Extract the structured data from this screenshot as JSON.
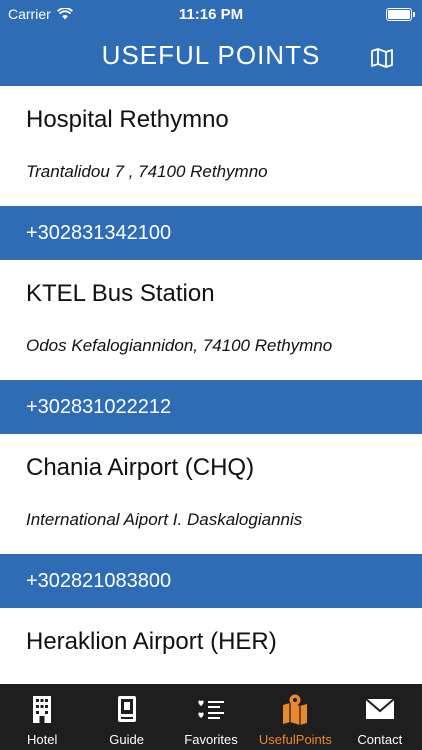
{
  "status": {
    "carrier": "Carrier",
    "time": "11:16 PM"
  },
  "nav": {
    "title": "USEFUL POINTS",
    "map_icon": "map-icon"
  },
  "places": [
    {
      "name": "Hospital Rethymno",
      "address": " Trantalidou 7 , 74100 Rethymno",
      "phone": "+302831342100"
    },
    {
      "name": "KTEL Bus Station",
      "address": "Odos Kefalogiannidon, 74100 Rethymno",
      "phone": "+302831022212"
    },
    {
      "name": "Chania Airport (CHQ)",
      "address": "International Aiport I. Daskalogiannis",
      "phone": "+302821083800"
    },
    {
      "name": "Heraklion Airport (HER)",
      "address": ""
    }
  ],
  "tabs": [
    {
      "label": "Hotel",
      "icon": "building-icon"
    },
    {
      "label": "Guide",
      "icon": "book-icon"
    },
    {
      "label": "Favorites",
      "icon": "favorites-list-icon"
    },
    {
      "label": "UsefulPoints",
      "icon": "map-pin-icon",
      "active": true
    },
    {
      "label": "Contact",
      "icon": "envelope-icon"
    }
  ],
  "colors": {
    "brand_blue": "#2f6cb6",
    "tab_bar": "#1e1e1e",
    "active_tab": "#e8892f"
  }
}
